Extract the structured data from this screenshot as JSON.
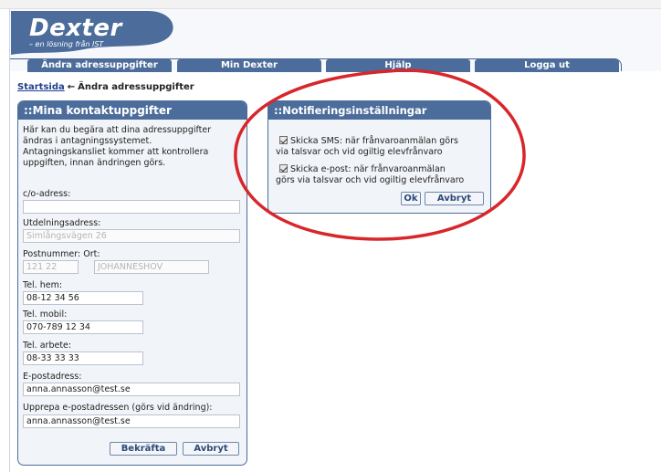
{
  "logo": {
    "name": "Dexter",
    "tagline": "– en lösning från IST"
  },
  "nav": {
    "tabs": [
      "Ändra adressuppgifter",
      "Min Dexter",
      "Hjälp",
      "Logga ut"
    ]
  },
  "breadcrumb": {
    "home": "Startsida",
    "current": "Ändra adressuppgifter"
  },
  "contact_panel": {
    "title": "::Mina kontaktuppgifter",
    "intro": [
      "Här kan du begära att dina adressuppgifter",
      "ändras i antagningssystemet.",
      "Antagningskansliet kommer att kontrollera",
      "uppgiften, innan ändringen görs."
    ],
    "co_label": "c/o-adress:",
    "co_value": "",
    "delivery_label": "Utdelningsadress:",
    "delivery_value": "Simlångsvägen 26",
    "postal_label": "Postnummer: Ort:",
    "postal_value": "121 22",
    "city_value": "JOHANNESHOV",
    "phone_home_label": "Tel. hem:",
    "phone_home_value": "08-12 34 56",
    "phone_mobile_label": "Tel. mobil:",
    "phone_mobile_value": "070-789 12 34",
    "phone_work_label": "Tel. arbete:",
    "phone_work_value": "08-33 33 33",
    "email_label": "E-postadress:",
    "email_value": "anna.annasson@test.se",
    "email_repeat_label": "Upprepa e-postadressen (görs vid ändring):",
    "email_repeat_value": "anna.annasson@test.se",
    "confirm_button": "Bekräfta",
    "cancel_button": "Avbryt"
  },
  "notify_panel": {
    "title": "::Notifieringsinställningar",
    "sms_line1": "Skicka SMS: när frånvaroanmälan görs",
    "sms_line2": "via talsvar och vid ogiltig elevfrånvaro",
    "sms_checked": true,
    "email_line1": "Skicka e-post: när frånvaroanmälan",
    "email_line2": "görs via talsvar och vid ogiltig elevfrånvaro",
    "email_checked": true,
    "ok_button": "Ok",
    "cancel_button": "Avbryt"
  },
  "colors": {
    "panel_header": "#4c6d9b",
    "panel_bg": "#f1f4f8",
    "link": "#1f3f8f",
    "highlight_circle": "#d8262b"
  }
}
